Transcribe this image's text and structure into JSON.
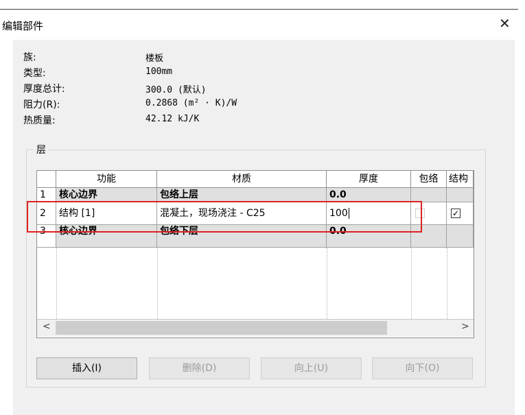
{
  "window": {
    "title": "编辑部件"
  },
  "properties": [
    {
      "label": "族:",
      "value": "楼板"
    },
    {
      "label": "类型:",
      "value": "100mm"
    },
    {
      "label": "厚度总计:",
      "value": "300.0 (默认)"
    },
    {
      "label": "阻力(R):",
      "value": "0.2868 (m² · K)/W"
    },
    {
      "label": "热质量:",
      "value": "42.12 kJ/K"
    }
  ],
  "layers": {
    "group_label": "层",
    "columns": [
      "功能",
      "材质",
      "厚度",
      "包络",
      "结构"
    ],
    "rows": [
      {
        "num": "1",
        "function": "核心边界",
        "material": "包络上层",
        "thickness": "0.0"
      },
      {
        "num": "2",
        "function": "结构 [1]",
        "material": "混凝土，现场浇注 - C25",
        "thickness": "100",
        "structural": "✓"
      },
      {
        "num": "3",
        "function": "核心边界",
        "material": "包络下层",
        "thickness": "0.0"
      }
    ]
  },
  "scrollbar": {
    "left": "<",
    "right": ">"
  },
  "buttons": {
    "insert": "插入(I)",
    "delete": "删除(D)",
    "up": "向上(U)",
    "down": "向下(O)"
  }
}
